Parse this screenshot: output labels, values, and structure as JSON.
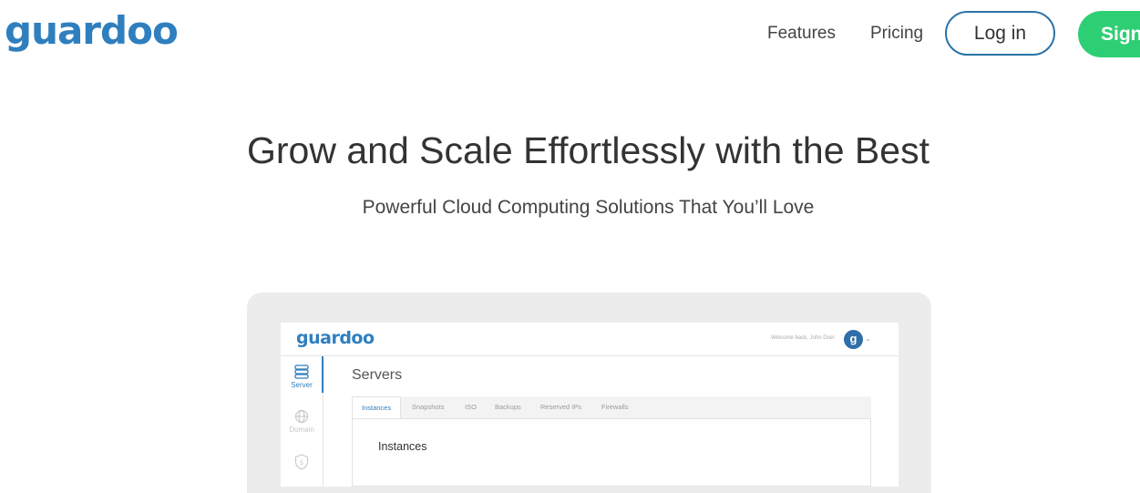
{
  "header": {
    "logo": "guardoo",
    "nav": [
      "Features",
      "Pricing"
    ],
    "login_label": "Log in",
    "signup_label": "Sign"
  },
  "hero": {
    "title": "Grow and Scale Effortlessly with the Best",
    "subtitle": "Powerful Cloud Computing Solutions That You’ll Love"
  },
  "app": {
    "logo": "guardoo",
    "welcome": "Welcome back, John Doe!",
    "avatar_letter": "g",
    "sidebar": [
      {
        "label": "Server",
        "icon": "server-icon",
        "active": true
      },
      {
        "label": "Domain",
        "icon": "globe-icon",
        "active": false
      },
      {
        "label": "",
        "icon": "shield-icon",
        "active": false
      }
    ],
    "page_title": "Servers",
    "tabs": [
      "Instances",
      "Snapshots",
      "ISO",
      "Backups",
      "Reserved IPs",
      "Firewalls"
    ],
    "active_tab": "Instances",
    "panel_title": "Instances"
  },
  "colors": {
    "brand_blue": "#2f7fbf",
    "signup_green": "#2ecf74",
    "login_border": "#2a73a8"
  }
}
